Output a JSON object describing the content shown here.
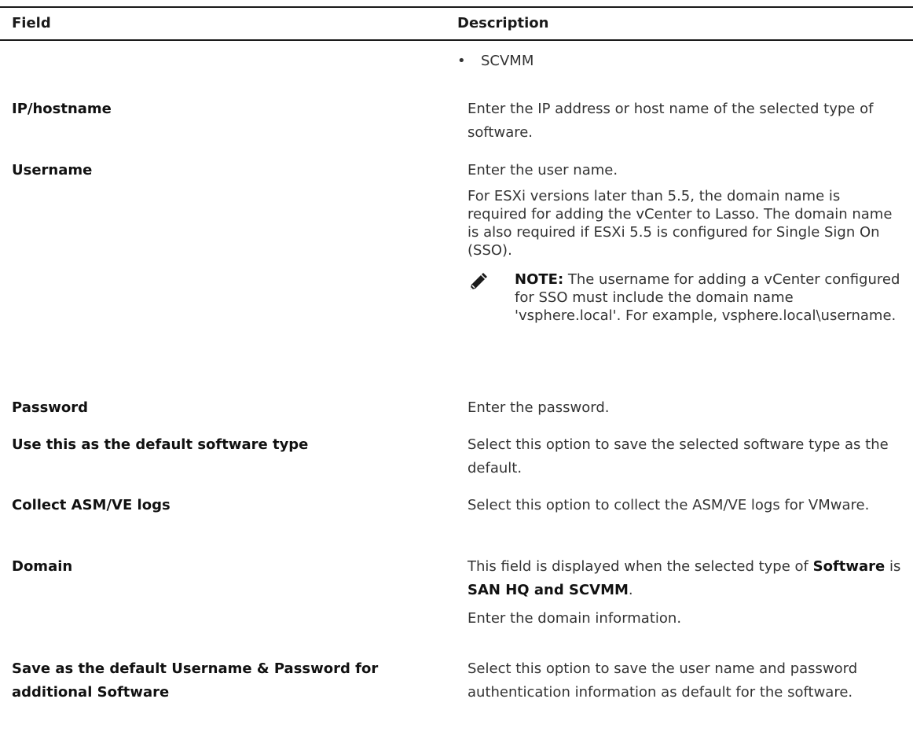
{
  "header": {
    "field_label": "Field",
    "description_label": "Description"
  },
  "rows": [
    {
      "field": "",
      "bullet": "SCVMM"
    },
    {
      "field": "IP/hostname",
      "desc": "Enter the IP address or host name of the selected type of software."
    },
    {
      "field": "Username",
      "desc": "Enter the user name.",
      "desc2": "For ESXi versions later than 5.5, the domain name is required for adding the vCenter to Lasso. The domain name is also required if ESXi 5.5 is configured for Single Sign On (SSO).",
      "note_label": "NOTE:",
      "note_text": " The username for adding a vCenter configured for SSO must include the domain name 'vsphere.local'. For example, vsphere.local\\username.",
      "note_icon": "pencil-note-icon"
    },
    {
      "field": "Password",
      "desc": "Enter the password."
    },
    {
      "field": "Use this as the default software type",
      "desc": "Select this option to save the selected software type as the default."
    },
    {
      "field": "Collect ASM/VE logs",
      "desc": "Select this option to collect the ASM/VE logs for VMware."
    },
    {
      "field": "Domain",
      "desc_pre": "This field is displayed when the selected type of ",
      "desc_bold1": "Software",
      "desc_mid": " is ",
      "desc_bold2": "SAN HQ and SCVMM",
      "desc_post": ".",
      "desc2": "Enter the domain information."
    },
    {
      "field": "Save as the default Username & Password for additional Software",
      "desc": "Select this option to save the user name and password authentication information as default for the software."
    }
  ]
}
